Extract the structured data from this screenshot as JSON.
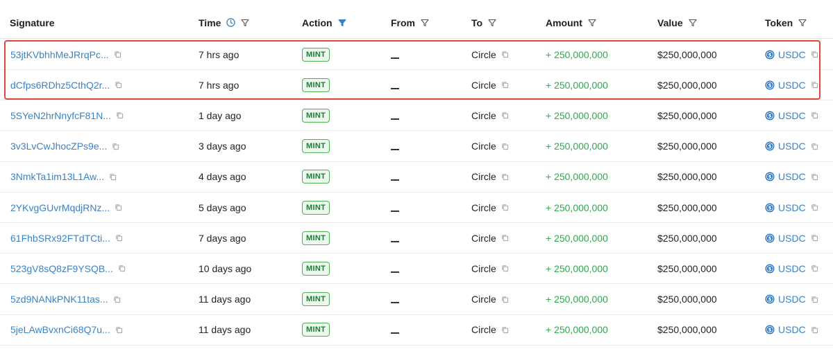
{
  "headers": {
    "signature": "Signature",
    "time": "Time",
    "action": "Action",
    "from": "From",
    "to": "To",
    "amount": "Amount",
    "value": "Value",
    "token": "Token"
  },
  "colors": {
    "link": "#3b82c4",
    "amount_green": "#2fa84f",
    "badge_border": "#4caf50",
    "highlight_border": "#d9483b",
    "active_filter": "#3b82c4"
  },
  "rows": [
    {
      "signature": "53jtKVbhhMeJRrqPc...",
      "time": "7 hrs ago",
      "action": "MINT",
      "from": "",
      "to": "Circle",
      "amount": "+ 250,000,000",
      "value": "$250,000,000",
      "token": "USDC"
    },
    {
      "signature": "dCfps6RDhz5CthQ2r...",
      "time": "7 hrs ago",
      "action": "MINT",
      "from": "",
      "to": "Circle",
      "amount": "+ 250,000,000",
      "value": "$250,000,000",
      "token": "USDC"
    },
    {
      "signature": "5SYeN2hrNnyfcF81N...",
      "time": "1 day ago",
      "action": "MINT",
      "from": "",
      "to": "Circle",
      "amount": "+ 250,000,000",
      "value": "$250,000,000",
      "token": "USDC"
    },
    {
      "signature": "3v3LvCwJhocZPs9e...",
      "time": "3 days ago",
      "action": "MINT",
      "from": "",
      "to": "Circle",
      "amount": "+ 250,000,000",
      "value": "$250,000,000",
      "token": "USDC"
    },
    {
      "signature": "3NmkTa1im13L1Aw...",
      "time": "4 days ago",
      "action": "MINT",
      "from": "",
      "to": "Circle",
      "amount": "+ 250,000,000",
      "value": "$250,000,000",
      "token": "USDC"
    },
    {
      "signature": "2YKvgGUvrMqdjRNz...",
      "time": "5 days ago",
      "action": "MINT",
      "from": "",
      "to": "Circle",
      "amount": "+ 250,000,000",
      "value": "$250,000,000",
      "token": "USDC"
    },
    {
      "signature": "61FhbSRx92FTdTCti...",
      "time": "7 days ago",
      "action": "MINT",
      "from": "",
      "to": "Circle",
      "amount": "+ 250,000,000",
      "value": "$250,000,000",
      "token": "USDC"
    },
    {
      "signature": "523gV8sQ8zF9YSQB...",
      "time": "10 days ago",
      "action": "MINT",
      "from": "",
      "to": "Circle",
      "amount": "+ 250,000,000",
      "value": "$250,000,000",
      "token": "USDC"
    },
    {
      "signature": "5zd9NANkPNK11tas...",
      "time": "11 days ago",
      "action": "MINT",
      "from": "",
      "to": "Circle",
      "amount": "+ 250,000,000",
      "value": "$250,000,000",
      "token": "USDC"
    },
    {
      "signature": "5jeLAwBvxnCi68Q7u...",
      "time": "11 days ago",
      "action": "MINT",
      "from": "",
      "to": "Circle",
      "amount": "+ 250,000,000",
      "value": "$250,000,000",
      "token": "USDC"
    }
  ]
}
